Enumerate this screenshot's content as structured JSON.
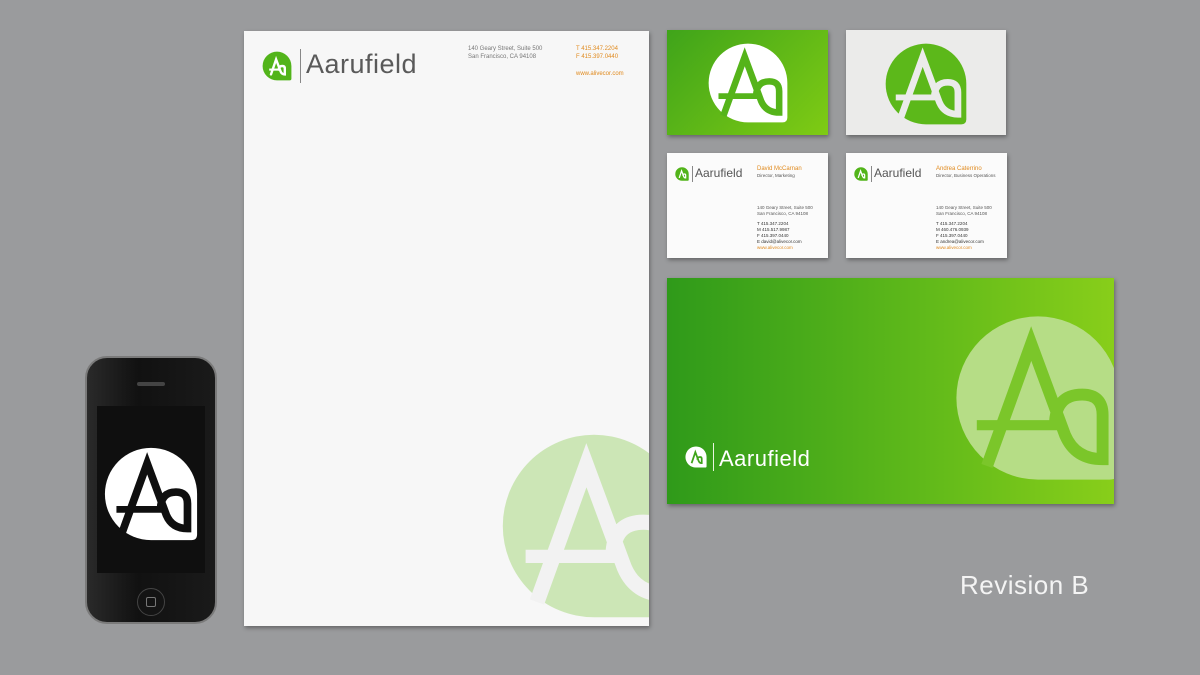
{
  "brand": {
    "name": "Aarufield",
    "mark": "Aa",
    "green": "#5cb81a",
    "accent": "#e08a1e"
  },
  "letterhead": {
    "address_line1": "140 Geary Street, Suite 500",
    "address_line2": "San Francisco, CA 94108",
    "phone": "T 415.347.2204",
    "fax": "F 415.397.0440",
    "web": "www.alivecor.com"
  },
  "cards": [
    {
      "person": "David McCarnan",
      "title": "Director, Marketing",
      "address_line1": "140 Geary Street, Suite 500",
      "address_line2": "San Francisco, CA 94108",
      "t": "T 415.347.2204",
      "m": "M 415.517.9987",
      "f": "F 415.397.0440",
      "e": "E david@alivecor.com",
      "web": "www.alivecor.com"
    },
    {
      "person": "Andrea Caterrino",
      "title": "Director, Business Operations",
      "address_line1": "140 Geary Street, Suite 500",
      "address_line2": "San Francisco, CA 94108",
      "t": "T 415.347.2204",
      "m": "M 460.476.0939",
      "f": "F 415.397.0440",
      "e": "E andrea@alivecor.com",
      "web": "www.alivecor.com"
    }
  ],
  "revision_label": "Revision B"
}
